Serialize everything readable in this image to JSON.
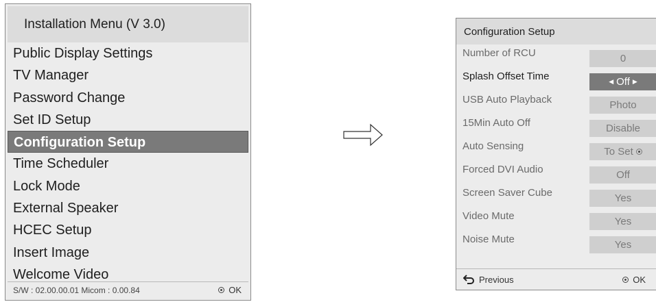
{
  "installation_menu": {
    "title": "Installation Menu (V 3.0)",
    "items": [
      {
        "label": "Public Display Settings"
      },
      {
        "label": "TV Manager"
      },
      {
        "label": "Password Change"
      },
      {
        "label": "Set ID Setup"
      },
      {
        "label": "Configuration Setup",
        "selected": true
      },
      {
        "label": "Time Scheduler"
      },
      {
        "label": "Lock Mode"
      },
      {
        "label": "External Speaker"
      },
      {
        "label": "HCEC Setup"
      },
      {
        "label": "Insert Image"
      },
      {
        "label": "Welcome Video"
      }
    ],
    "footer": {
      "version_text": "S/W : 02.00.00.01 Micom : 0.00.84",
      "ok_label": "OK",
      "ok_icon": "ok-button-icon"
    }
  },
  "arrow_icon": "right-arrow-icon",
  "configuration_setup": {
    "title": "Configuration Setup",
    "rows": [
      {
        "label": "Number of RCU",
        "value": "0"
      },
      {
        "label": "Splash Offset Time",
        "value": "Off",
        "selected": true,
        "arrows": true
      },
      {
        "label": "USB Auto Playback",
        "value": "Photo"
      },
      {
        "label": "15Min Auto Off",
        "value": "Disable"
      },
      {
        "label": "Auto Sensing",
        "value": "To Set",
        "ok_icon": true
      },
      {
        "label": "Forced DVI Audio",
        "value": "Off"
      },
      {
        "label": "Screen Saver Cube",
        "value": "Yes"
      },
      {
        "label": "Video Mute",
        "value": "Yes"
      },
      {
        "label": "Noise Mute",
        "value": "Yes"
      }
    ],
    "footer": {
      "previous_label": "Previous",
      "previous_icon": "back-icon",
      "ok_label": "OK",
      "ok_icon": "ok-button-icon"
    }
  },
  "colors": {
    "panel_bg": "#ececec",
    "title_bg": "#dcdcdc",
    "selected_bg": "#7a7a7a",
    "value_bg": "#cfcfcf"
  }
}
